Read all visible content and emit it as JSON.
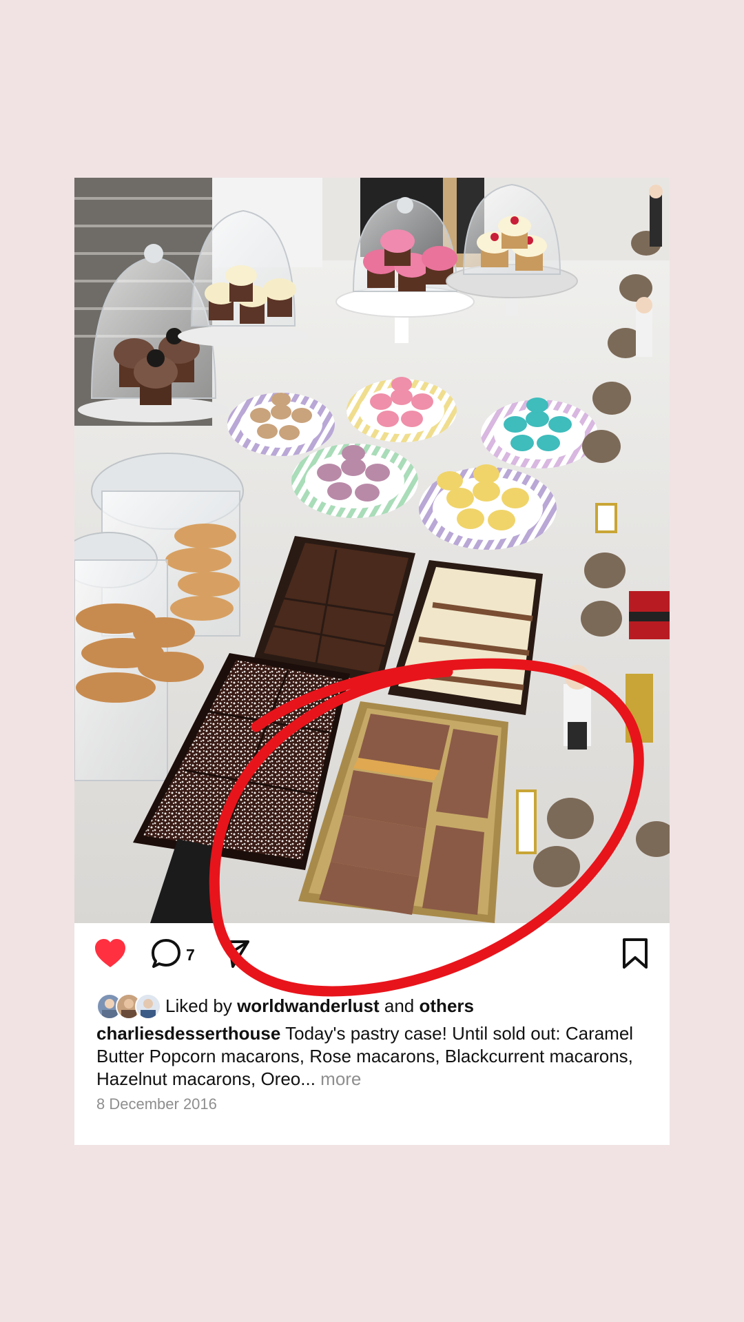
{
  "post": {
    "comment_count": "7",
    "liked_by_prefix": "Liked by",
    "liked_by_user": "worldwanderlust",
    "liked_by_and": "and",
    "liked_by_others": "others",
    "username": "charliesdesserthouse",
    "caption": "Today's pastry case! Until sold out: Caramel Butter Popcorn macarons, Rose macarons, Blackcurrent macarons, Hazelnut macarons, Oreo...",
    "more_label": "more",
    "date": "8 December 2016"
  },
  "icons": {
    "like": "heart-icon",
    "comment": "comment-icon",
    "share": "send-icon",
    "save": "bookmark-icon"
  },
  "colors": {
    "background": "#f1e3e4",
    "like": "#ff3040",
    "annotation": "#e8141b",
    "muted_text": "#8e8e8e"
  }
}
